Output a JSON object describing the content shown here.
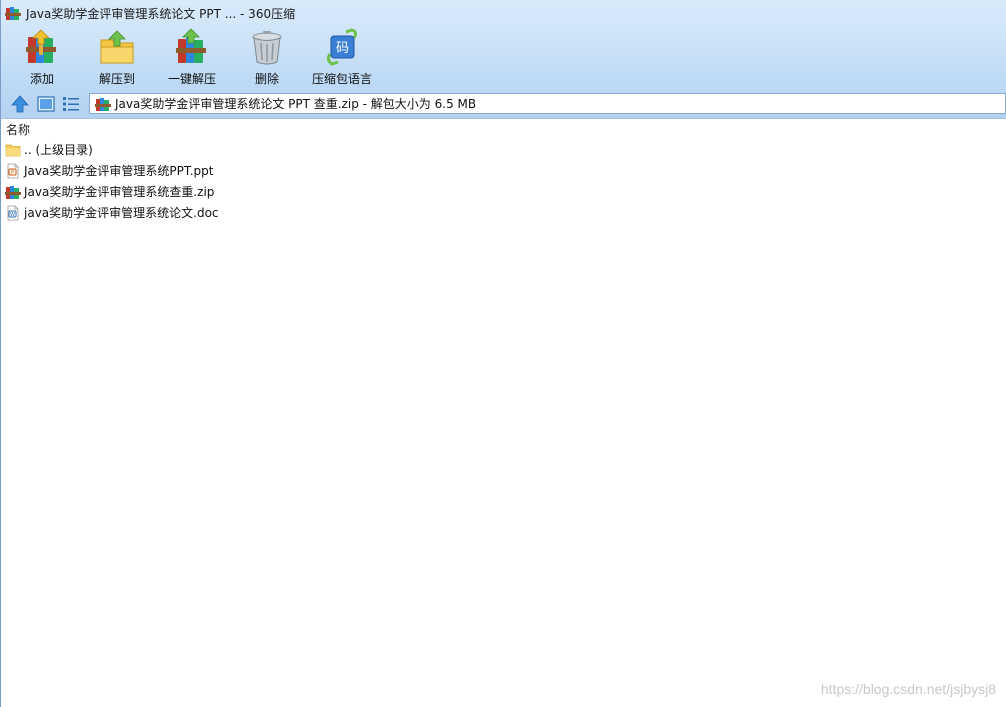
{
  "window": {
    "title": "Java奖助学金评审管理系统论文 PPT ... - 360压缩",
    "icon": "archive-icon"
  },
  "toolbar": {
    "items": [
      {
        "label": "添加",
        "icon": "add-books-icon"
      },
      {
        "label": "解压到",
        "icon": "extract-to-folder-icon"
      },
      {
        "label": "一键解压",
        "icon": "one-click-extract-icon"
      },
      {
        "label": "删除",
        "icon": "trash-can-icon"
      },
      {
        "label": "压缩包语言",
        "icon": "code-language-icon",
        "badge": "码"
      }
    ]
  },
  "nav": {
    "up_icon": "arrow-up-icon",
    "view_large_icon": "large-icon-view-icon",
    "view_list_icon": "list-view-icon",
    "address": "Java奖助学金评审管理系统论文 PPT 查重.zip - 解包大小为 6.5 MB"
  },
  "columns": {
    "name": "名称"
  },
  "files": [
    {
      "name": ".. (上级目录)",
      "icon": "folder-icon"
    },
    {
      "name": "Java奖助学金评审管理系统PPT.ppt",
      "icon": "ppt-file-icon"
    },
    {
      "name": "Java奖助学金评审管理系统查重.zip",
      "icon": "zip-archive-icon"
    },
    {
      "name": "java奖助学金评审管理系统论文.doc",
      "icon": "doc-file-icon"
    }
  ],
  "watermark": "https://blog.csdn.net/jsjbysj8",
  "colors": {
    "toolbar_gradient_top": "#d9ebfb",
    "toolbar_gradient_bottom": "#b4d3f1",
    "accent_blue": "#3b7fd4"
  }
}
